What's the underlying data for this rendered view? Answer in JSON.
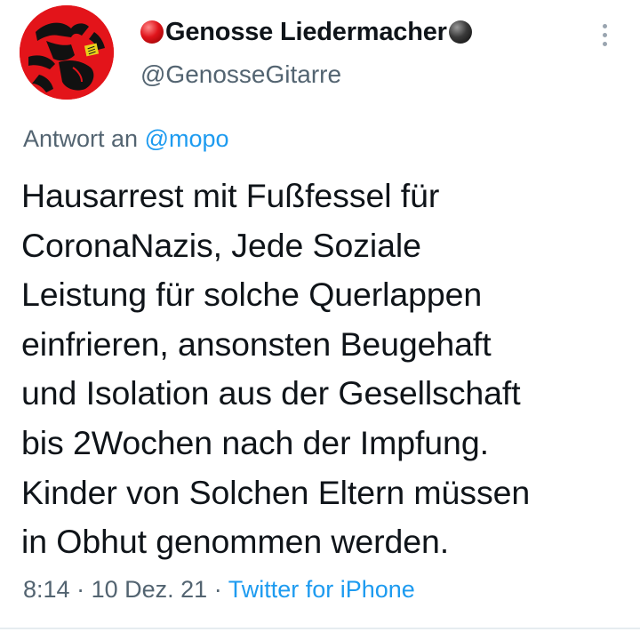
{
  "author": {
    "display_name": "Genosse Liedermacher",
    "handle": "@GenosseGitarre",
    "avatar": "avatar-red-figure"
  },
  "reply": {
    "prefix": "Antwort an",
    "mention": "@mopo"
  },
  "tweet": {
    "text": "Hausarrest mit Fußfessel für\nCoronaNazis, Jede Soziale\nLeistung für solche Querlappen\neinfrieren, ansonsten Beugehaft\nund Isolation aus der Gesellschaft\nbis 2Wochen nach der Impfung.\nKinder von Solchen Eltern müssen\nin Obhut genommen werden."
  },
  "meta": {
    "time": "8:14",
    "separator": "·",
    "date": "10 Dez. 21",
    "source": "Twitter for iPhone"
  },
  "icons": {
    "name_prefix": "red-ball-icon",
    "name_suffix": "black-ball-icon",
    "menu": "more-vertical-icon"
  },
  "colors": {
    "link": "#1d9bf0",
    "secondary_text": "#536471",
    "primary_text": "#0f1419",
    "avatar_background": "#e3141a"
  }
}
